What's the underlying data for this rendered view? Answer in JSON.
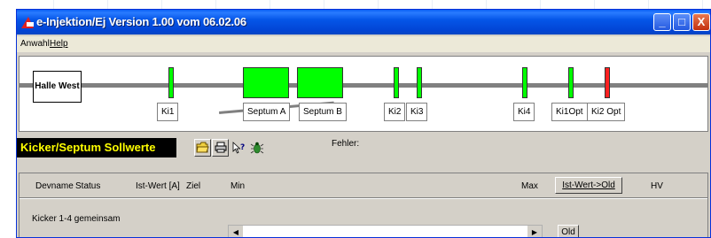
{
  "window": {
    "title": "e-Injektion/Ej Version 1.00 vom 06.02.06",
    "buttons": {
      "minimize": "_",
      "maximize": "□",
      "close": "X"
    }
  },
  "menu": {
    "anwahl": "Anwahl",
    "help": "Help"
  },
  "beamline": {
    "start_label": "Halle West",
    "elements": [
      {
        "label": "Ki1",
        "state": "green"
      },
      {
        "label": "Septum A",
        "state": "green"
      },
      {
        "label": "Septum B",
        "state": "green"
      },
      {
        "label": "Ki2",
        "state": "green"
      },
      {
        "label": "Ki3",
        "state": "green"
      },
      {
        "label": "Ki4",
        "state": "green"
      },
      {
        "label": "Ki1Opt",
        "state": "green"
      },
      {
        "label": "Ki2 Opt",
        "state": "red"
      }
    ],
    "colors": {
      "ok": "#00ff00",
      "error": "#ff2020",
      "beam": "#808080"
    }
  },
  "toolbar": {
    "panel_title": "Kicker/Septum Sollwerte",
    "fehler_label": "Fehler:",
    "icons": [
      "open-folder-icon",
      "print-icon",
      "help-pointer-icon",
      "bug-icon"
    ]
  },
  "table": {
    "headers": {
      "devname": "Devname",
      "status": "Status",
      "istwert": "Ist-Wert [A]",
      "ziel": "Ziel",
      "min": "Min",
      "max": "Max",
      "ist_old_button": "Ist-Wert->Old",
      "hv": "HV"
    },
    "rows": [
      {
        "label": "Kicker 1-4 gemeinsam",
        "old_button": "Old"
      }
    ]
  }
}
